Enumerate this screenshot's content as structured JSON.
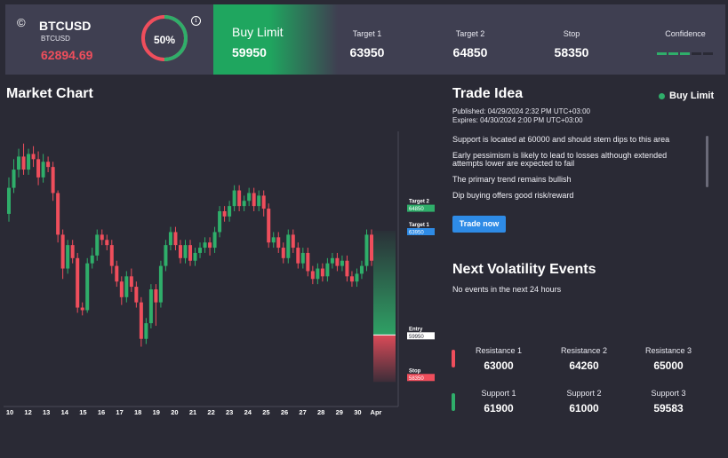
{
  "header": {
    "logo": "©",
    "symbol": "BTCUSD",
    "symbol_sub": "BTCUSD",
    "price": "62894.69",
    "gauge_percent": 50,
    "gauge_label": "50%",
    "info": "i",
    "buy_limit_label": "Buy Limit",
    "buy_limit_value": "59950",
    "target1_label": "Target 1",
    "target1_value": "63950",
    "target2_label": "Target 2",
    "target2_value": "64850",
    "stop_label": "Stop",
    "stop_value": "58350",
    "confidence_label": "Confidence",
    "confidence_level": 3,
    "confidence_max": 5
  },
  "market": {
    "title": "Market Chart",
    "xticks": [
      "10",
      "12",
      "13",
      "14",
      "15",
      "16",
      "17",
      "18",
      "19",
      "20",
      "21",
      "22",
      "23",
      "24",
      "25",
      "26",
      "27",
      "28",
      "29",
      "30",
      "Apr"
    ],
    "levels": {
      "target2": {
        "label": "Target 2",
        "value": "64850"
      },
      "target1": {
        "label": "Target 1",
        "value": "63950"
      },
      "entry": {
        "label": "Entry",
        "value": "59950"
      },
      "stop": {
        "label": "Stop",
        "value": "58350"
      }
    }
  },
  "chart_data": {
    "type": "candlestick",
    "ylim": [
      57200,
      67700
    ],
    "levels": {
      "target2": 64850,
      "target1": 63950,
      "entry": 59950,
      "stop": 58350
    },
    "candles": [
      [
        64600,
        65600,
        64300,
        66000
      ],
      [
        65600,
        66300,
        65400,
        66700
      ],
      [
        66300,
        66800,
        66000,
        67100
      ],
      [
        66800,
        66300,
        66100,
        67300
      ],
      [
        66300,
        66900,
        66100,
        67100
      ],
      [
        66900,
        66700,
        66400,
        67200
      ],
      [
        66700,
        66000,
        65700,
        67000
      ],
      [
        66000,
        66600,
        65800,
        66900
      ],
      [
        66600,
        66400,
        66200,
        66800
      ],
      [
        66400,
        65400,
        65100,
        66600
      ],
      [
        65400,
        63800,
        63500,
        65500
      ],
      [
        63800,
        62500,
        62100,
        64000
      ],
      [
        62500,
        63400,
        62300,
        63600
      ],
      [
        63400,
        62900,
        62700,
        63600
      ],
      [
        62900,
        61000,
        60800,
        63100
      ],
      [
        61000,
        60900,
        60700,
        61200
      ],
      [
        60900,
        62700,
        60800,
        62900
      ],
      [
        62700,
        63000,
        62500,
        63300
      ],
      [
        63000,
        63800,
        62800,
        64000
      ],
      [
        63800,
        63600,
        63400,
        64000
      ],
      [
        63600,
        63400,
        63200,
        63800
      ],
      [
        63400,
        62600,
        62300,
        63600
      ],
      [
        62600,
        62000,
        61800,
        62800
      ],
      [
        62000,
        61400,
        61100,
        62200
      ],
      [
        61400,
        62200,
        61200,
        62400
      ],
      [
        62200,
        61800,
        61600,
        62500
      ],
      [
        61800,
        61200,
        61000,
        62000
      ],
      [
        61200,
        59800,
        59500,
        61400
      ],
      [
        59800,
        60400,
        59600,
        60600
      ],
      [
        60400,
        61700,
        60200,
        61900
      ],
      [
        61700,
        61200,
        60300,
        61900
      ],
      [
        61200,
        62600,
        61000,
        62800
      ],
      [
        62600,
        63400,
        62400,
        63600
      ],
      [
        63400,
        63900,
        63200,
        64100
      ],
      [
        63900,
        63400,
        63200,
        64100
      ],
      [
        63400,
        62900,
        62700,
        63600
      ],
      [
        62900,
        63400,
        62700,
        63600
      ],
      [
        63400,
        62800,
        62600,
        63600
      ],
      [
        62800,
        63100,
        62600,
        63300
      ],
      [
        63100,
        63300,
        62900,
        63500
      ],
      [
        63300,
        63500,
        63100,
        63700
      ],
      [
        63500,
        63300,
        63000,
        63700
      ],
      [
        63300,
        63900,
        63100,
        64100
      ],
      [
        63900,
        64700,
        63700,
        64900
      ],
      [
        64700,
        64500,
        64300,
        64900
      ],
      [
        64500,
        64900,
        64300,
        65100
      ],
      [
        64900,
        65500,
        64700,
        65700
      ],
      [
        65500,
        64900,
        64700,
        65700
      ],
      [
        64900,
        65100,
        64700,
        65300
      ],
      [
        65100,
        65400,
        64900,
        65600
      ],
      [
        65400,
        64900,
        64700,
        65600
      ],
      [
        64900,
        65300,
        64700,
        65500
      ],
      [
        65300,
        64800,
        64500,
        65500
      ],
      [
        64800,
        63500,
        63300,
        65000
      ],
      [
        63500,
        63700,
        63300,
        63900
      ],
      [
        63700,
        63300,
        63100,
        63900
      ],
      [
        63300,
        62900,
        62700,
        63500
      ],
      [
        62900,
        63800,
        62700,
        64000
      ],
      [
        63800,
        63300,
        63100,
        64000
      ],
      [
        63300,
        62700,
        62500,
        63500
      ],
      [
        62700,
        63100,
        62500,
        63300
      ],
      [
        63100,
        62400,
        62200,
        63300
      ],
      [
        62400,
        62100,
        61900,
        62600
      ],
      [
        62100,
        62500,
        61900,
        62700
      ],
      [
        62500,
        62200,
        62000,
        62700
      ],
      [
        62200,
        62700,
        62000,
        62900
      ],
      [
        62700,
        62900,
        62500,
        63100
      ],
      [
        62900,
        62600,
        62400,
        63100
      ],
      [
        62600,
        62800,
        62400,
        63000
      ],
      [
        62800,
        62200,
        62000,
        63000
      ],
      [
        62200,
        62000,
        61800,
        62400
      ],
      [
        62000,
        62300,
        61800,
        62500
      ],
      [
        62300,
        62600,
        62100,
        62800
      ],
      [
        62600,
        63800,
        62400,
        64000
      ],
      [
        63800,
        62800,
        62600,
        64000
      ]
    ]
  },
  "trade": {
    "title": "Trade Idea",
    "legend": "Buy Limit",
    "published": "Published:  04/29/2024 2:32 PM UTC+03:00",
    "expires": "Expires:  04/30/2024 2:00 PM UTC+03:00",
    "ideas": [
      "Support is located at 60000 and should stem dips to this area",
      "Early pessimism is likely to lead to losses although extended attempts lower are expected to fail",
      "The primary trend remains bullish",
      "Dip buying offers good risk/reward"
    ],
    "button": "Trade now"
  },
  "volatility": {
    "title": "Next Volatility Events",
    "subtitle": "No events in the next 24 hours"
  },
  "levels": {
    "resistance": [
      {
        "label": "Resistance 1",
        "value": "63000"
      },
      {
        "label": "Resistance 2",
        "value": "64260"
      },
      {
        "label": "Resistance 3",
        "value": "65000"
      }
    ],
    "support": [
      {
        "label": "Support 1",
        "value": "61900"
      },
      {
        "label": "Support 2",
        "value": "61000"
      },
      {
        "label": "Support 3",
        "value": "59583"
      }
    ]
  },
  "colors": {
    "up": "#2fae6a",
    "down": "#ef4e5c",
    "accent": "#2e8be6",
    "panel": "#3f3f51",
    "background": "#2a2a35"
  }
}
